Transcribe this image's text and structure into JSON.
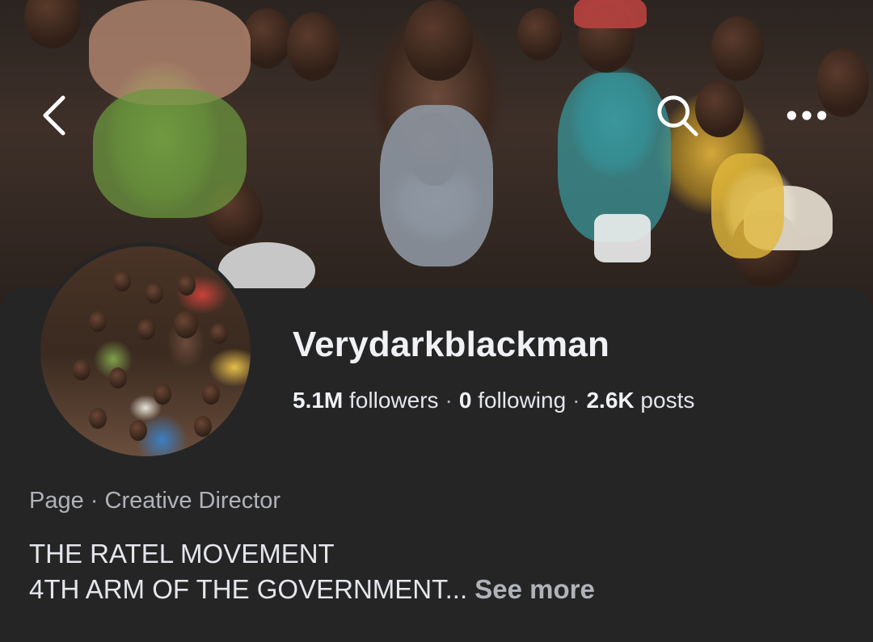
{
  "header": {
    "back_icon": "chevron-left-icon",
    "search_icon": "search-icon",
    "more_icon": "more-horizontal-icon"
  },
  "profile": {
    "name": "Verydarkblackman",
    "stats": {
      "followers_count": "5.1M",
      "followers_label": "followers",
      "following_count": "0",
      "following_label": "following",
      "posts_count": "2.6K",
      "posts_label": "posts",
      "separator": "·"
    },
    "category_line": "Page · Creative Director",
    "bio_line1": "THE RATEL MOVEMENT",
    "bio_line2": "4TH ARM OF THE GOVERNMENT...",
    "see_more": "See more"
  },
  "colors": {
    "background": "#252526",
    "primary_text": "#f0f2f5",
    "secondary_text": "#b0b3b8"
  }
}
